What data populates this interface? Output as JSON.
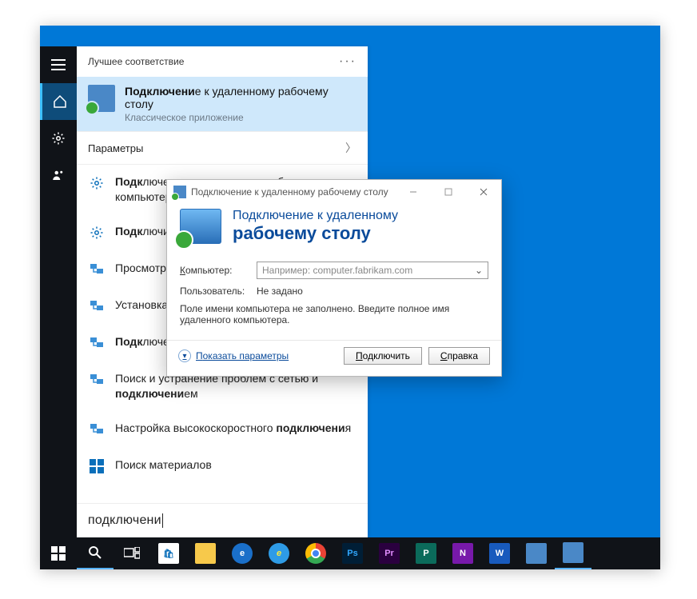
{
  "search": {
    "header_title": "Лучшее соответствие",
    "more": "···",
    "bestmatch": {
      "title_prefix_bold": "Подключени",
      "title_suffix": "е к удаленному рабочему столу",
      "subtitle": "Классическое приложение"
    },
    "params_label": "Параметры",
    "items": [
      {
        "icon": "gear",
        "text_parts": [
          "<b>Подк</b>лючение к удаленному рабочему компьютеру"
        ]
      },
      {
        "icon": "gear",
        "text_parts": [
          "<b>Подк</b>лючиться к рабочему месту домена"
        ]
      },
      {
        "icon": "network",
        "text_parts": [
          "Просмотр сетевых <b>подключени</b>й"
        ]
      },
      {
        "icon": "network",
        "text_parts": [
          "Установка VPN-<b>подключени</b>я"
        ]
      },
      {
        "icon": "network",
        "text_parts": [
          "<b>Подк</b>лючение к удаленному рабочему столу"
        ]
      },
      {
        "icon": "network",
        "text_parts": [
          "Поиск и устранение проблем с сетью и <b>подключени</b>ем"
        ]
      },
      {
        "icon": "network",
        "text_parts": [
          "Настройка высокоскоростного <b>подключени</b>я"
        ]
      },
      {
        "icon": "store",
        "text_parts": [
          "Поиск материалов"
        ]
      }
    ],
    "query": "подключени"
  },
  "rdp": {
    "title": "Подключение к удаленному рабочему столу",
    "banner_line1": "Подключение к удаленному",
    "banner_line2": "рабочему столу",
    "computer_label": "Компьютер:",
    "computer_label_u": "К",
    "computer_placeholder": "Например: computer.fabrikam.com",
    "user_label": "Пользователь:",
    "user_value": "Не задано",
    "hint": "Поле имени компьютера не заполнено. Введите полное имя удаленного компьютера.",
    "show_params": "Показать параметры",
    "show_params_u": "П",
    "connect": "Подключить",
    "connect_u": "П",
    "help": "Справка",
    "help_u": "С"
  },
  "taskbar": {
    "items": [
      "start",
      "search",
      "taskview",
      "store",
      "explorer",
      "edge",
      "ie",
      "chrome",
      "ps",
      "pr",
      "word-like",
      "onenote",
      "word",
      "remote1",
      "remote2"
    ]
  }
}
